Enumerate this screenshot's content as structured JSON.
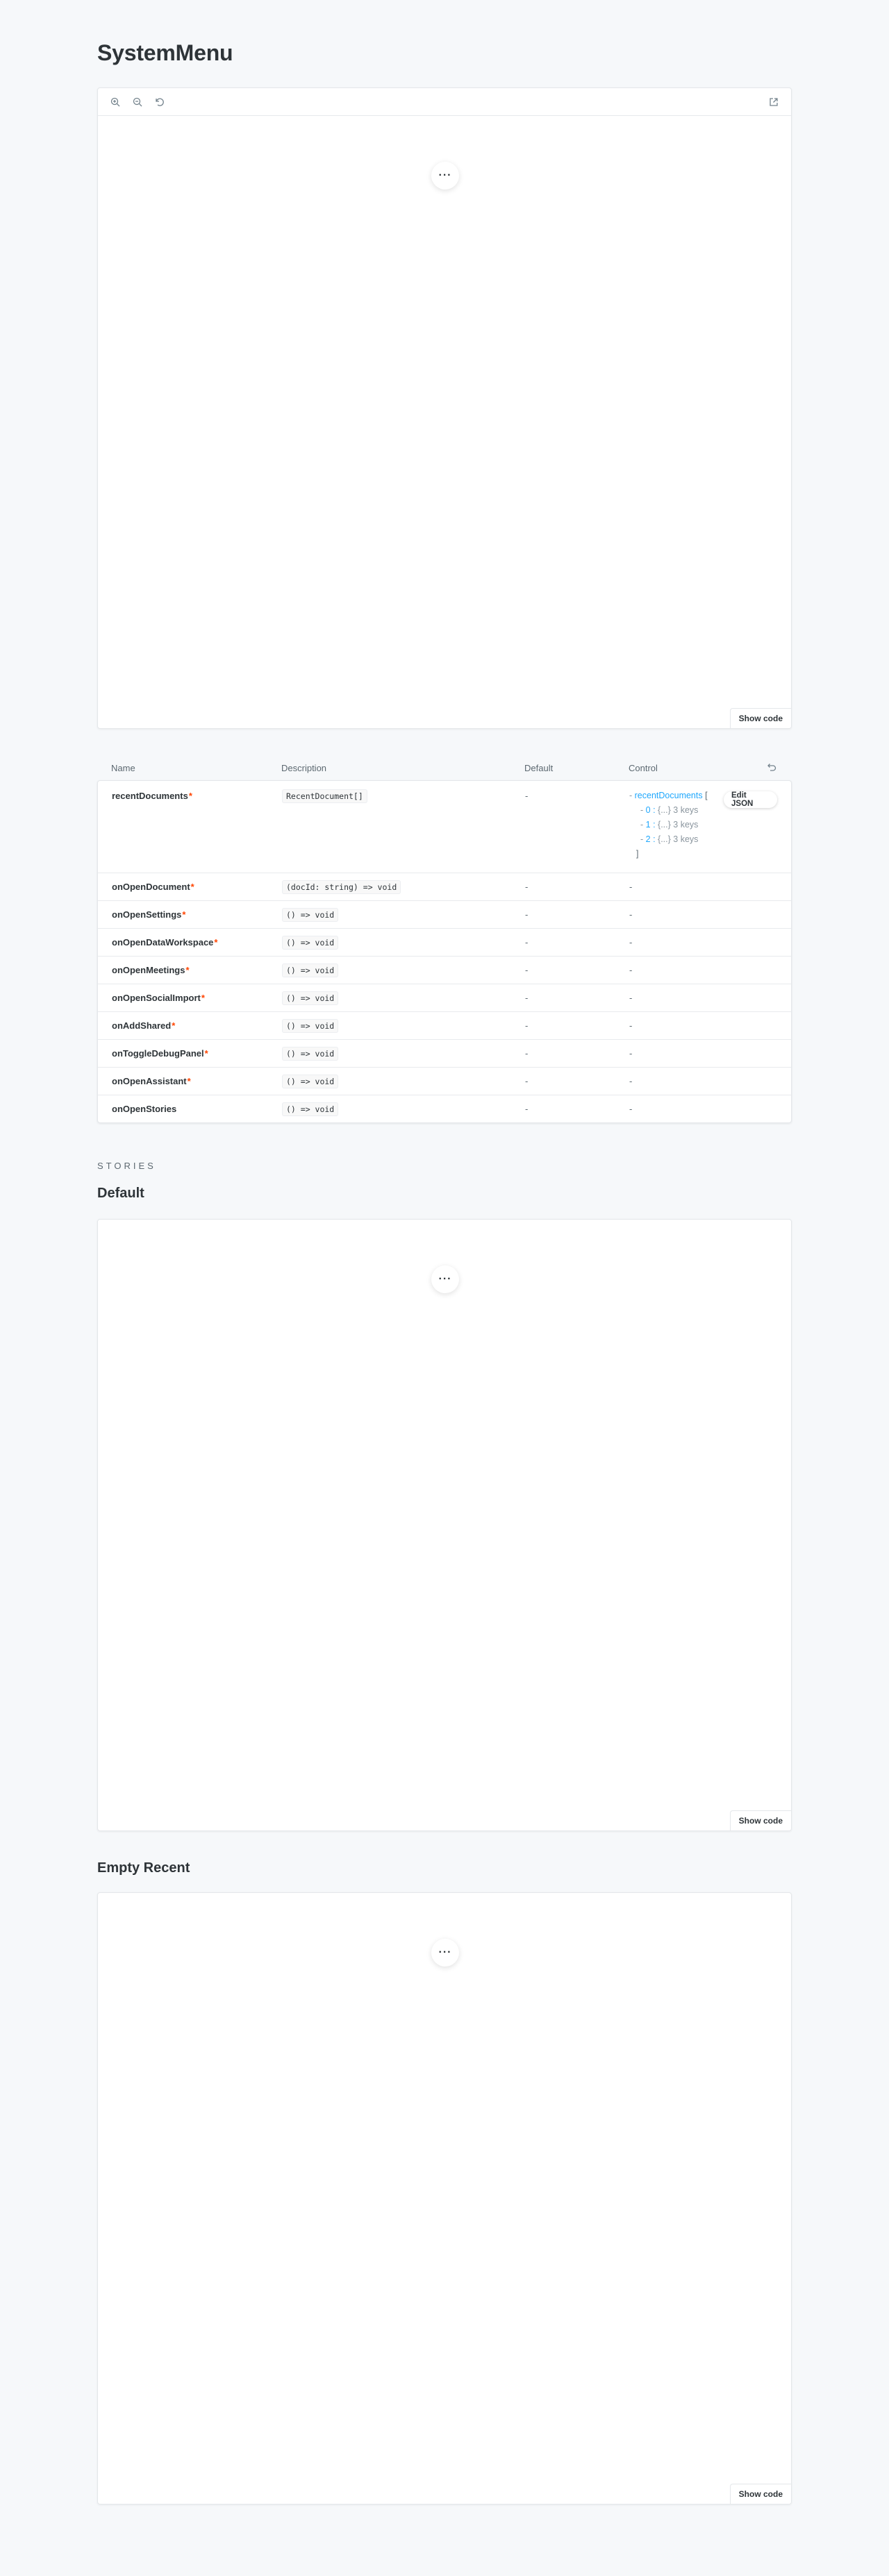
{
  "page": {
    "title": "SystemMenu"
  },
  "primary_canvas": {
    "menu_label": "···",
    "show_code": "Show code"
  },
  "args_table": {
    "headers": {
      "name": "Name",
      "description": "Description",
      "default": "Default",
      "control": "Control"
    },
    "required_marker": "*",
    "rows": [
      {
        "name": "recentDocuments",
        "description": "RecentDocument[]",
        "default": "-"
      },
      {
        "name": "onOpenDocument",
        "description": "(docId: string) => void",
        "default": "-",
        "control": "-"
      },
      {
        "name": "onOpenSettings",
        "description": "() => void",
        "default": "-",
        "control": "-"
      },
      {
        "name": "onOpenDataWorkspace",
        "description": "() => void",
        "default": "-",
        "control": "-"
      },
      {
        "name": "onOpenMeetings",
        "description": "() => void",
        "default": "-",
        "control": "-"
      },
      {
        "name": "onOpenSocialImport",
        "description": "() => void",
        "default": "-",
        "control": "-"
      },
      {
        "name": "onAddShared",
        "description": "() => void",
        "default": "-",
        "control": "-"
      },
      {
        "name": "onToggleDebugPanel",
        "description": "() => void",
        "default": "-",
        "control": "-"
      },
      {
        "name": "onOpenAssistant",
        "description": "() => void",
        "default": "-",
        "control": "-"
      },
      {
        "name": "onOpenStories",
        "description": "() => void",
        "default": "-",
        "control": "-"
      }
    ],
    "json_control": {
      "root_key": "recentDocuments",
      "open_bracket": "[",
      "close_bracket": "]",
      "items": [
        {
          "index": "0",
          "summary": "{...}",
          "count": "3 keys"
        },
        {
          "index": "1",
          "summary": "{...}",
          "count": "3 keys"
        },
        {
          "index": "2",
          "summary": "{...}",
          "count": "3 keys"
        }
      ],
      "edit_label": "Edit JSON"
    }
  },
  "stories": {
    "section_label": "STORIES",
    "items": [
      {
        "title": "Default",
        "menu_label": "···",
        "show_code": "Show code"
      },
      {
        "title": "Empty Recent",
        "menu_label": "···",
        "show_code": "Show code"
      }
    ]
  },
  "icons": {
    "zoom_in": "zoom-in-icon",
    "zoom_out": "zoom-out-icon",
    "reset_zoom": "reset-zoom-icon",
    "open_new_tab": "open-new-tab-icon",
    "reset_controls": "undo-icon"
  },
  "colors": {
    "required": "#ff4400",
    "json_key": "#1ea7fd"
  }
}
